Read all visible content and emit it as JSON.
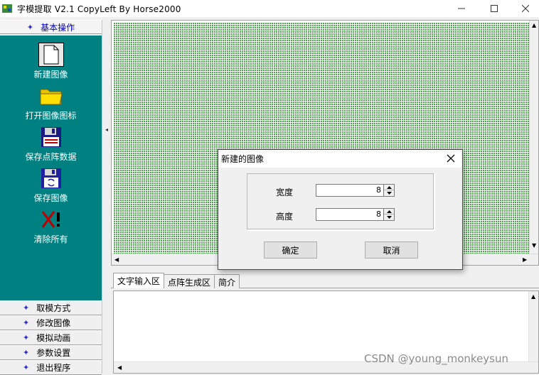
{
  "window": {
    "title": "字模提取 V2.1  CopyLeft By Horse2000"
  },
  "left_panel": {
    "header": "基本操作",
    "tools": [
      {
        "label": "新建图像",
        "icon": "new-file-icon"
      },
      {
        "label": "打开图像图标",
        "icon": "folder-icon"
      },
      {
        "label": "保存点阵数据",
        "icon": "floppy-disk-icon"
      },
      {
        "label": "保存图像",
        "icon": "save-image-icon"
      },
      {
        "label": "清除所有",
        "icon": "clear-all-icon"
      }
    ],
    "footer_items": [
      "取模方式",
      "修改图像",
      "模拟动画",
      "参数设置",
      "退出程序"
    ]
  },
  "tabs": [
    "文字输入区",
    "点阵生成区",
    "简介"
  ],
  "dialog": {
    "title": "新建的图像",
    "width_label": "宽度",
    "width_value": "8",
    "height_label": "高度",
    "height_value": "8",
    "ok_label": "确定",
    "cancel_label": "取消"
  },
  "watermark": "CSDN @young_monkeysun",
  "colors": {
    "panel_teal": "#008080",
    "grid_green": "#4aa84a",
    "header_text": "#0000c0"
  }
}
